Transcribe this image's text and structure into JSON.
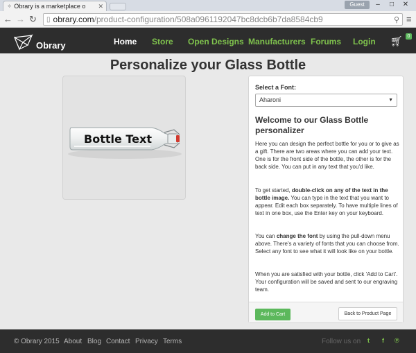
{
  "browser": {
    "tab_title": "Obrary is a marketplace o",
    "guest_label": "Guest",
    "url_host": "obrary.com",
    "url_path": "/product-configuration/508a0961192047bc8dcb6b7da8584cb9"
  },
  "navbar": {
    "brand": "Obrary",
    "links": [
      "Home",
      "Store",
      "Open Designs",
      "Manufacturers",
      "Forums",
      "Login"
    ],
    "active_link": "Home",
    "cart_count": "0",
    "accent": "#7fc24d",
    "background": "#2d2d2d"
  },
  "page": {
    "title": "Personalize your Glass Bottle",
    "bottle_text": "Bottle Text"
  },
  "config": {
    "font_label": "Select a Font:",
    "font_value": "Aharoni",
    "welcome_title": "Welcome to our Glass Bottle personalizer",
    "p1": "Here you can design the perfect bottle for you or to give as a gift. There are two areas where you can add your text. One is for the front side of the bottle, the other is for the back side. You can put in any text that you'd like.",
    "p2_pre": "To get started, ",
    "p2_bold": "double-click on any of the text in the bottle image.",
    "p2_post": " You can type in the text that you want to appear. Edit each box separately. To have multiple lines of text in one box, use the Enter key on your keyboard.",
    "p3_pre": "You can ",
    "p3_bold": "change the font",
    "p3_post": " by using the pull-down menu above. There's a variety of fonts that you can choose from. Select any font to see what it will look like on your bottle.",
    "p4": "When you are satisfied with your bottle, click 'Add to Cart'. Your configuration will be saved and sent to our engraving team.",
    "add_to_cart": "Add to Cart",
    "back_to_product": "Back to Product Page"
  },
  "footer": {
    "copyright": "© Obrary 2015",
    "links": [
      "About",
      "Blog",
      "Contact",
      "Privacy",
      "Terms"
    ],
    "follow_label": "Follow us on",
    "social_icons": [
      "twitter-icon",
      "facebook-icon",
      "pinterest-icon"
    ]
  }
}
